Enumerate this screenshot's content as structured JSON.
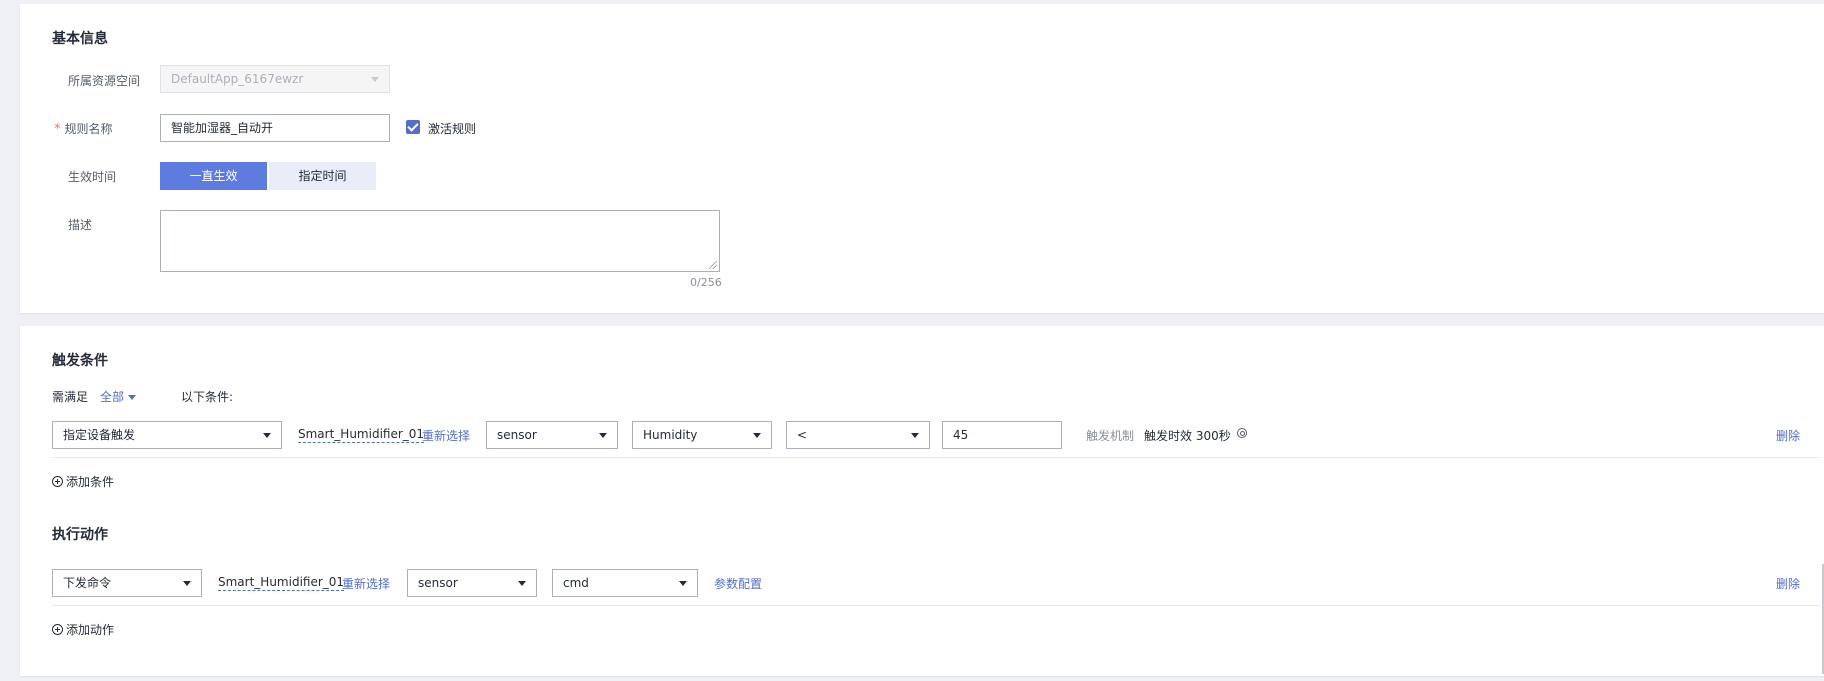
{
  "basic_info": {
    "title": "基本信息",
    "resource_space_label": "所属资源空间",
    "resource_space_value": "DefaultApp_6167ewzr",
    "rule_name_star": "*",
    "rule_name_label": "规则名称",
    "rule_name_value": "智能加湿器_自动开",
    "activate_label": "激活规则",
    "activate_checked": true,
    "effective_time_label": "生效时间",
    "effective_options": [
      "一直生效",
      "指定时间"
    ],
    "effective_selected": "一直生效",
    "description_label": "描述",
    "description_value": "",
    "description_counter": "0/256"
  },
  "trigger": {
    "title": "触发条件",
    "need_prefix": "需满足",
    "match_mode": "全部",
    "need_suffix": "以下条件:",
    "condition": {
      "type": "指定设备触发",
      "device": "Smart_Humidifier_01",
      "reselect": "重新选择",
      "service": "sensor",
      "property": "Humidity",
      "operator": "<",
      "value": "45",
      "mechanism_label": "触发机制",
      "mechanism_value": "触发时效 300秒",
      "delete": "删除"
    },
    "add_label": "添加条件"
  },
  "action": {
    "title": "执行动作",
    "row": {
      "type": "下发命令",
      "device": "Smart_Humidifier_01",
      "reselect": "重新选择",
      "service": "sensor",
      "command": "cmd",
      "params": "参数配置",
      "delete": "删除"
    },
    "add_label": "添加动作"
  },
  "colors": {
    "accent": "#5e7ce0",
    "link": "#526ecc",
    "background": "#eef0f5"
  }
}
